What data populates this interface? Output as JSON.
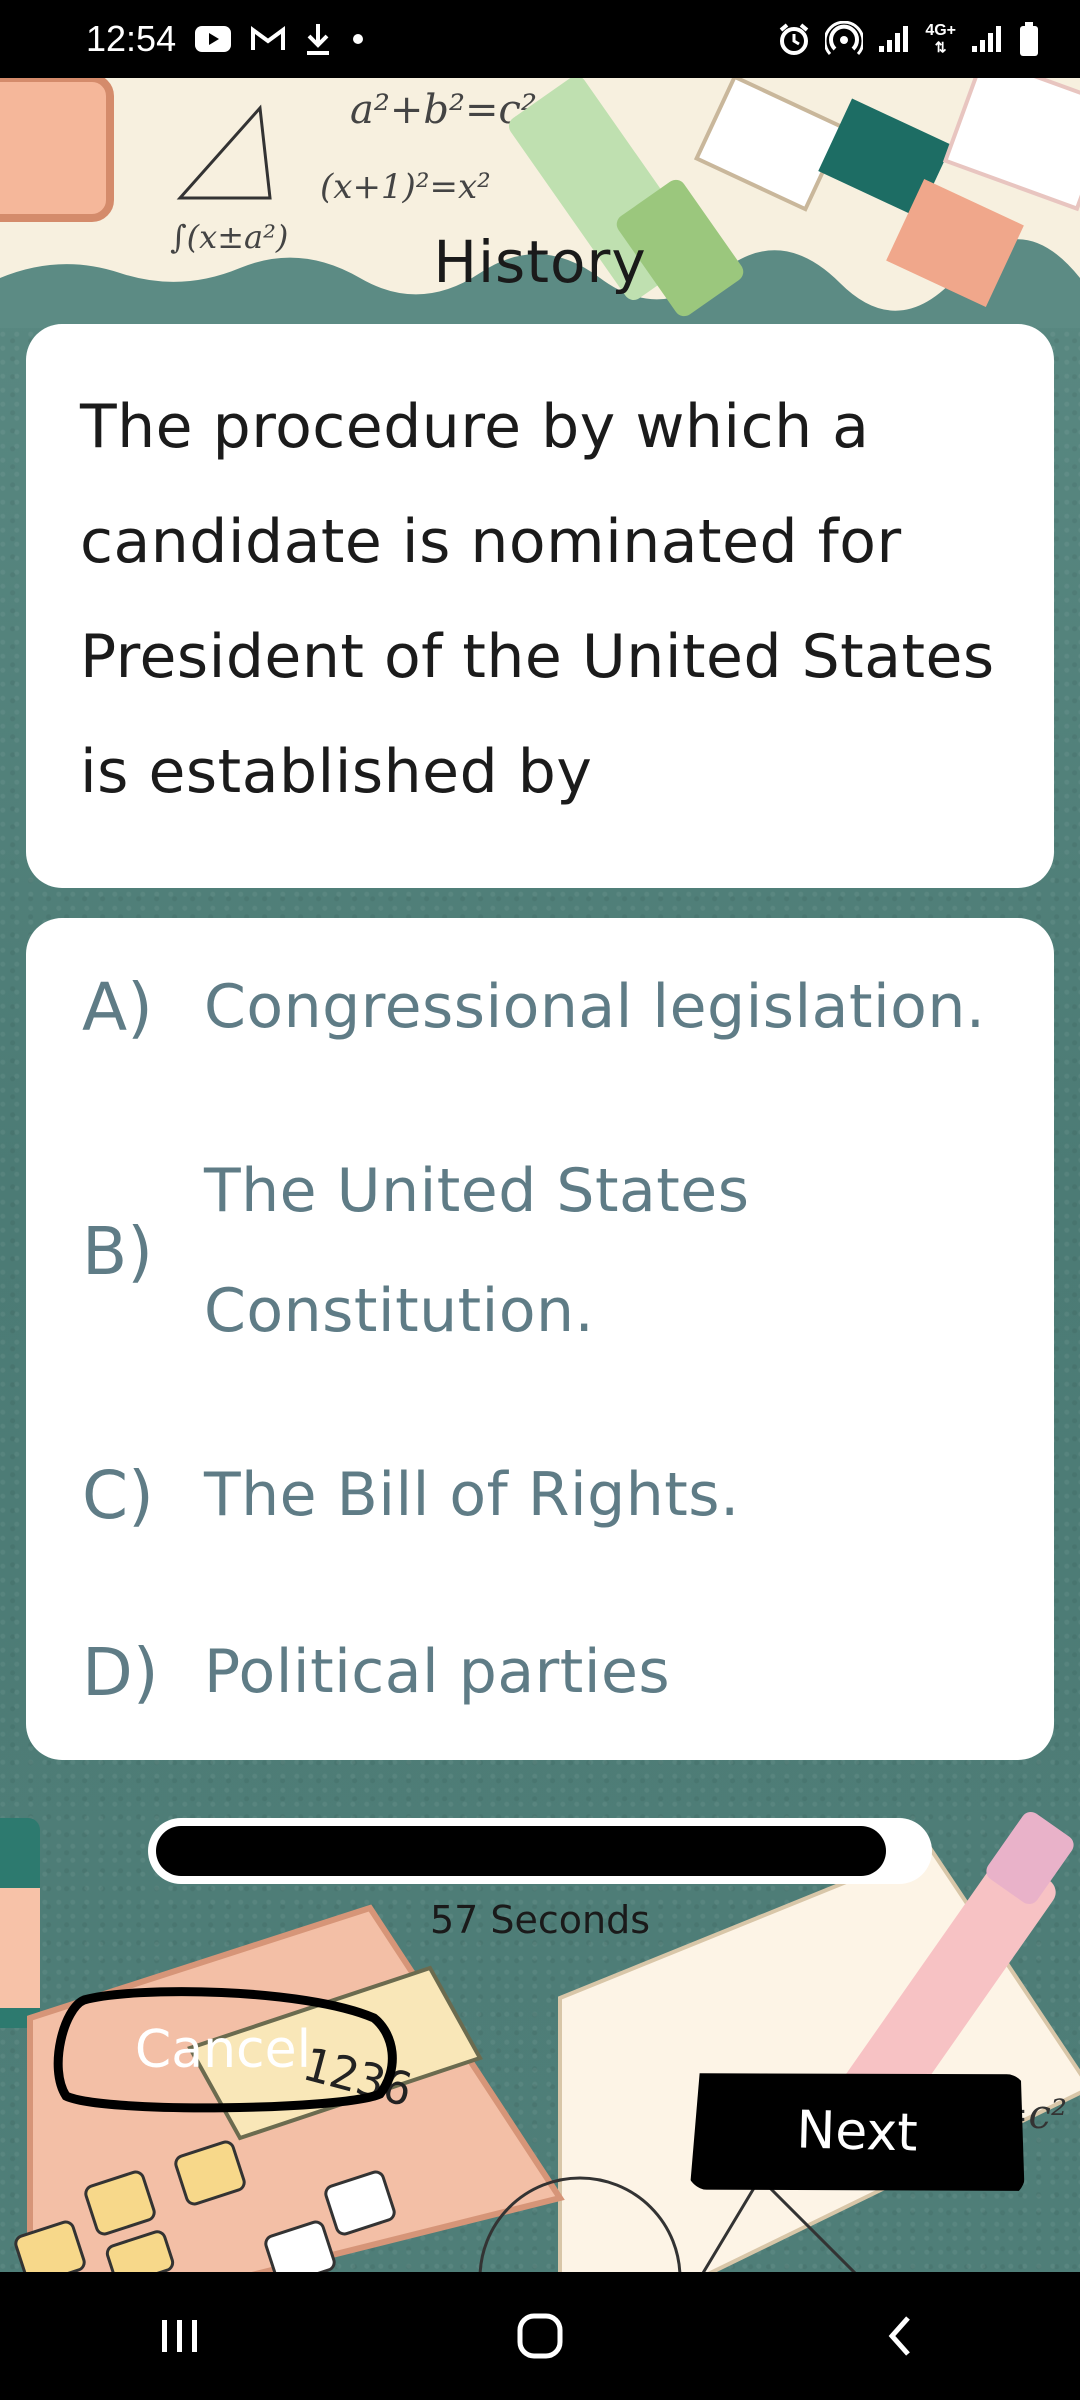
{
  "status_bar": {
    "time": "12:54",
    "network_label": "4G+",
    "icons": [
      "youtube-icon",
      "gmail-icon",
      "download-icon",
      "dot-icon",
      "alarm-icon",
      "hotspot-icon",
      "signal-icon",
      "signal-icon",
      "battery-icon"
    ]
  },
  "header": {
    "subject": "History"
  },
  "question": {
    "text": "The procedure by which a candidate is nominated for President of the United States is established by"
  },
  "answers": [
    {
      "letter": "A)",
      "text": "Congressional legislation."
    },
    {
      "letter": "B)",
      "text": "The United States Constitution."
    },
    {
      "letter": "C)",
      "text": "The Bill of Rights."
    },
    {
      "letter": "D)",
      "text": "Political parties"
    }
  ],
  "timer": {
    "label": "57 Seconds",
    "progress": 0.95
  },
  "buttons": {
    "cancel": "Cancel",
    "next": "Next"
  },
  "colors": {
    "background": "#4f7f79",
    "answer_text": "#5f7c86",
    "card": "#ffffff",
    "progress_fill": "#000000"
  },
  "nav": {
    "items": [
      "recents-icon",
      "home-icon",
      "back-icon"
    ]
  }
}
